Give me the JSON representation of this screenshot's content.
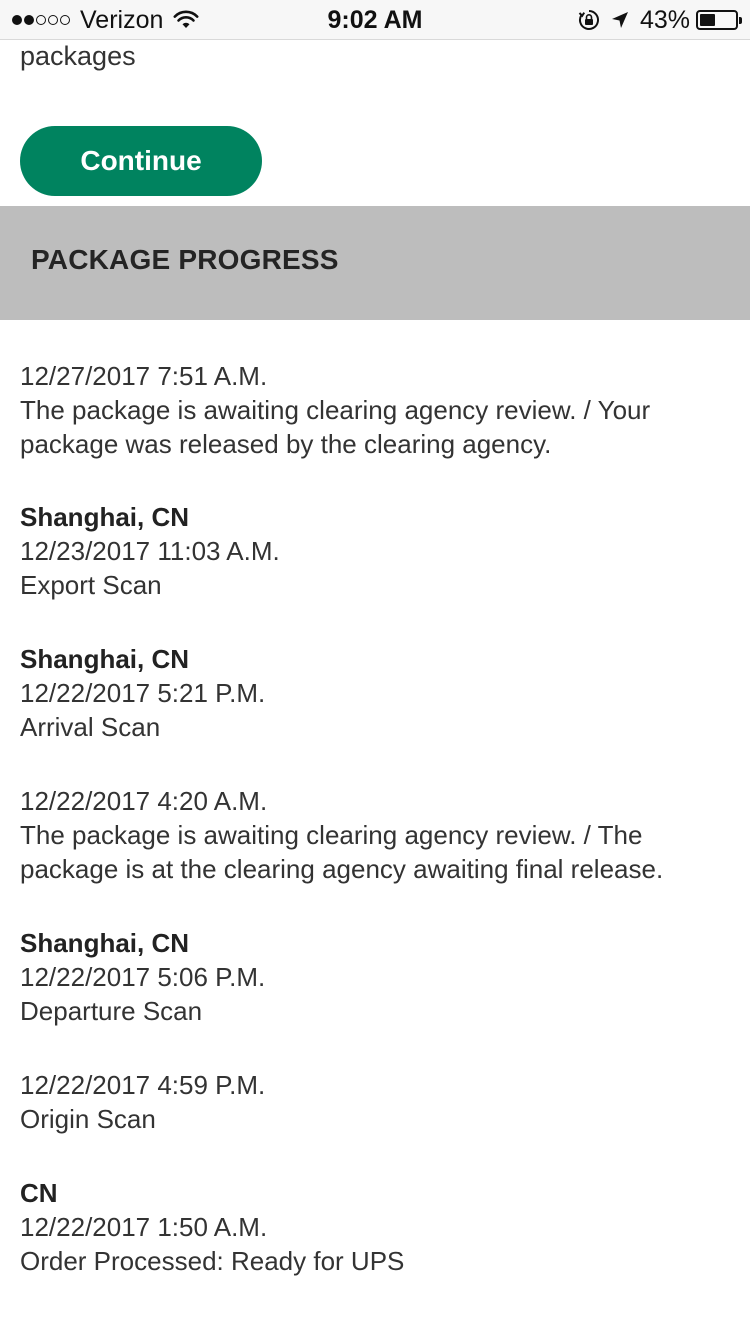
{
  "status_bar": {
    "carrier": "Verizon",
    "time": "9:02 AM",
    "battery_percent": "43%",
    "battery_level": 0.43,
    "signal_bars_filled": 2,
    "signal_bars_total": 5
  },
  "content": {
    "cut_off_text": "packages",
    "continue_label": "Continue",
    "accent_color": "#00835f"
  },
  "progress": {
    "title": "PACKAGE PROGRESS",
    "events": [
      {
        "location": "",
        "datetime": "12/27/2017 7:51 A.M.",
        "description": "The package is awaiting clearing agency review. / Your package was released by the clearing agency."
      },
      {
        "location": "Shanghai, CN",
        "datetime": "12/23/2017 11:03 A.M.",
        "description": "Export Scan"
      },
      {
        "location": "Shanghai, CN",
        "datetime": "12/22/2017 5:21 P.M.",
        "description": "Arrival Scan"
      },
      {
        "location": "",
        "datetime": "12/22/2017 4:20 A.M.",
        "description": "The package is awaiting clearing agency review. / The package is at the clearing agency awaiting final release."
      },
      {
        "location": "Shanghai, CN",
        "datetime": "12/22/2017 5:06 P.M.",
        "description": "Departure Scan"
      },
      {
        "location": "",
        "datetime": "12/22/2017 4:59 P.M.",
        "description": "Origin Scan"
      },
      {
        "location": "CN",
        "datetime": "12/22/2017 1:50 A.M.",
        "description": "Order Processed: Ready for UPS"
      }
    ]
  }
}
